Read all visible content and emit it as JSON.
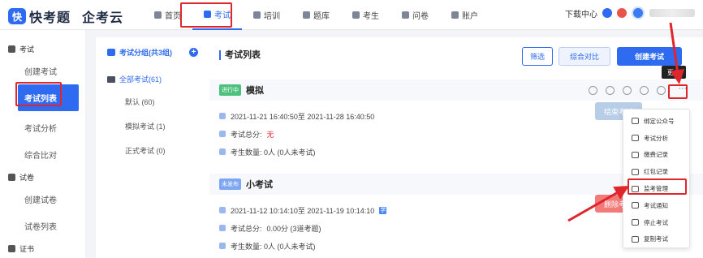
{
  "brand": {
    "logo_mark": "快",
    "name1": "快考题",
    "name2": "企考云"
  },
  "nav": [
    {
      "label": "首页",
      "icon": "home-icon"
    },
    {
      "label": "考试",
      "icon": "exam-icon",
      "active": true
    },
    {
      "label": "培训",
      "icon": "training-icon"
    },
    {
      "label": "题库",
      "icon": "question-bank-icon"
    },
    {
      "label": "考生",
      "icon": "candidate-icon"
    },
    {
      "label": "问卷",
      "icon": "survey-icon"
    },
    {
      "label": "账户",
      "icon": "account-icon"
    }
  ],
  "top_right": {
    "download": "下载中心"
  },
  "sidebar": {
    "exam_group": "考试",
    "exam_items": [
      "创建考试",
      "考试列表",
      "考试分析",
      "综合比对"
    ],
    "paper_group": "试卷",
    "paper_items": [
      "创建试卷",
      "试卷列表"
    ],
    "cert_group": "证书"
  },
  "group_panel": {
    "title": "考试分组(共3组)",
    "all": "全部考试(61)",
    "subs": [
      "默认 (60)",
      "模拟考试 (1)",
      "正式考试 (0)"
    ]
  },
  "main": {
    "title": "考试列表",
    "filter_btn": "筛选",
    "compare_btn": "综合对比",
    "create_btn": "创建考试"
  },
  "cards": [
    {
      "status": "进行中",
      "name": "模拟",
      "time": "2021-11-21 16:40:50至 2021-11-28 16:40:50",
      "score_label": "考试总分:",
      "score_value": "无",
      "count": "考生数量:  0人 (0人未考试)",
      "action": "结束考试"
    },
    {
      "status": "未发布",
      "name": "小考试",
      "time": "2021-11-12 10:14:10至 2021-11-19 10:14:10",
      "badge": "学",
      "score_label": "考试总分:",
      "score_value": "0.00分  (3道考题)",
      "count": "考生数量:  0人 (0人未考试)",
      "action": "删除考试"
    }
  ],
  "tooltip": "更多",
  "dropdown": [
    "绑定公众号",
    "考试分析",
    "缴费记录",
    "红包记录",
    "监考管理",
    "考试通知",
    "停止考试",
    "复制考试"
  ]
}
